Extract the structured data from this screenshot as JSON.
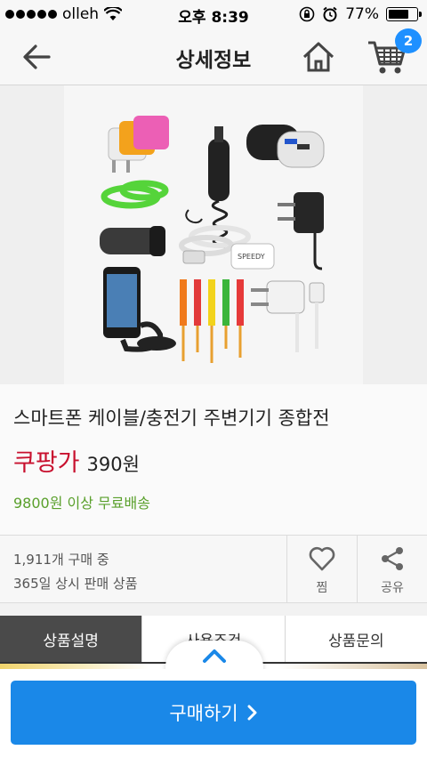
{
  "status_bar": {
    "carrier": "olleh",
    "time": "오후 8:39",
    "battery": "77%",
    "battery_level": 0.77
  },
  "nav": {
    "title": "상세정보",
    "cart_count": "2"
  },
  "product": {
    "title": "스마트폰 케이블/충전기 주변기기 종합전",
    "price_label": "쿠팡가",
    "price": "390원",
    "shipping": "9800원 이상 무료배송",
    "image_label": "SPEEDY"
  },
  "stats": {
    "purchases": "1,911개 구매 중",
    "availability": "365일 상시 판매 상품"
  },
  "actions": {
    "like_label": "찜",
    "share_label": "공유"
  },
  "tabs": [
    {
      "label": "상품설명",
      "active": true
    },
    {
      "label": "사용조건",
      "active": false
    },
    {
      "label": "상품문의",
      "active": false
    }
  ],
  "buy_button": {
    "label": "구매하기"
  },
  "colors": {
    "accent": "#1a88e8",
    "price_red": "#c8102e",
    "shipping_green": "#5aa02c",
    "badge_blue": "#1e90ff"
  }
}
